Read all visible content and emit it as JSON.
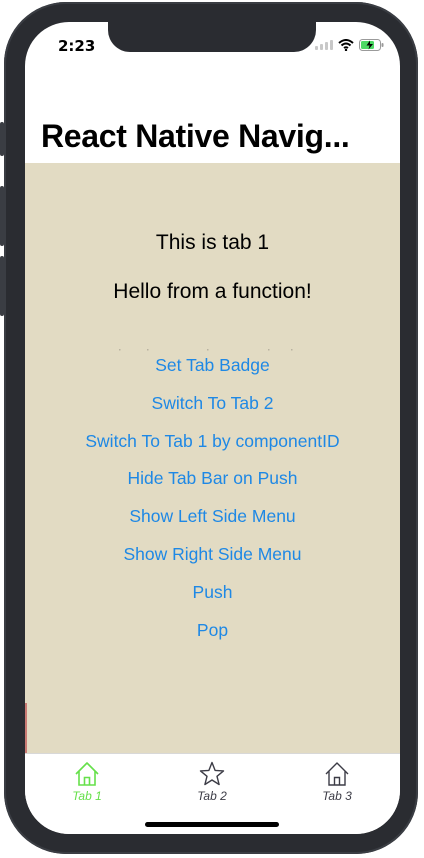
{
  "status_bar": {
    "time": "2:23"
  },
  "nav": {
    "title": "React Native Navig..."
  },
  "content": {
    "line1": "This is tab 1",
    "line2": "Hello from a function!",
    "buttons": [
      "Set Tab Badge",
      "Switch To Tab 2",
      "Switch To Tab 1 by componentID",
      "Hide Tab Bar on Push",
      "Show Left Side Menu",
      "Show Right Side Menu",
      "Push",
      "Pop"
    ]
  },
  "tabbar": {
    "tabs": [
      {
        "label": "Tab 1",
        "icon": "home-icon",
        "selected": true
      },
      {
        "label": "Tab 2",
        "icon": "star-icon",
        "selected": false
      },
      {
        "label": "Tab 3",
        "icon": "home-icon",
        "selected": false
      }
    ]
  },
  "colors": {
    "content_background": "#e2dbc3",
    "button_text": "#1e88e5",
    "tab_selected": "#66e04a",
    "tab_unselected": "#3c3c46"
  }
}
